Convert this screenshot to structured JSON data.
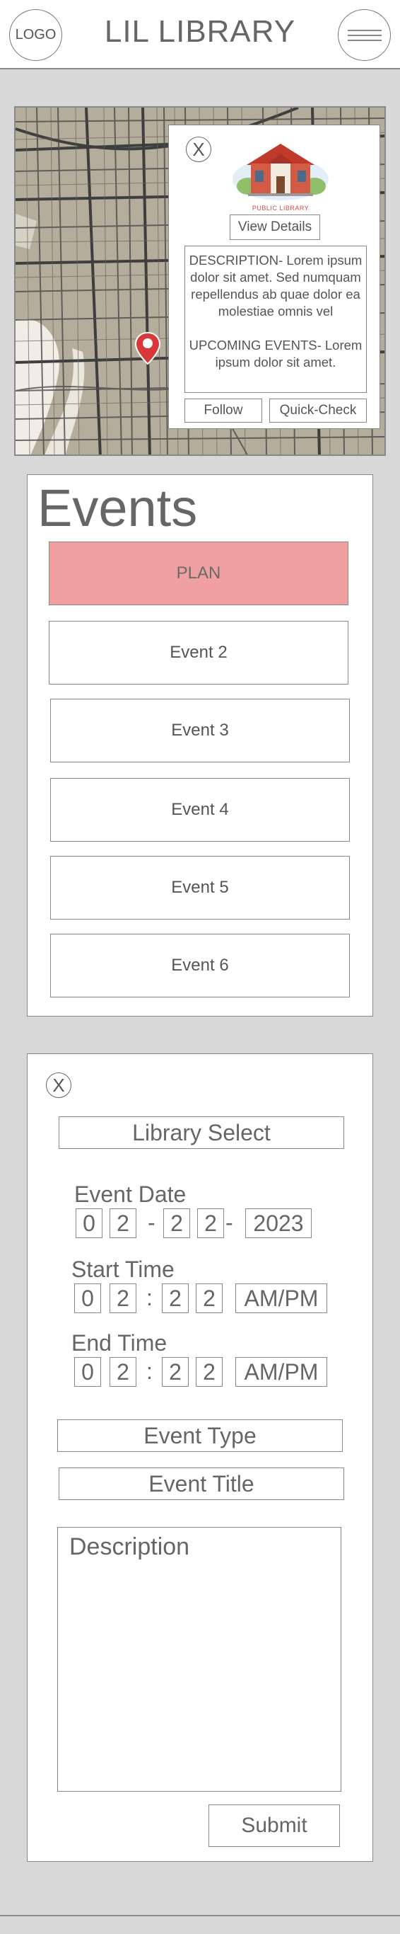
{
  "header": {
    "logo": "LOGO",
    "title": "LIL LIBRARY"
  },
  "map_popup": {
    "close": "X",
    "library_caption": "PUBLIC LIBRARY",
    "view_details": "View Details",
    "description": "DESCRIPTION- Lorem ipsum dolor sit amet. Sed numquam repellendus ab quae dolor ea molestiae omnis vel",
    "upcoming": "UPCOMING EVENTS- Lorem ipsum dolor sit amet.",
    "follow": "Follow",
    "quick_check": "Quick-Check"
  },
  "events": {
    "title": "Events",
    "items": [
      "PLAN",
      "Event 2",
      "Event 3",
      "Event 4",
      "Event 5",
      "Event 6"
    ]
  },
  "form": {
    "close": "X",
    "library_select": "Library Select",
    "event_date_label": "Event Date",
    "date": {
      "m1": "0",
      "m2": "2",
      "d1": "2",
      "d2": "2",
      "year": "2023",
      "sep1": "-",
      "sep2": "-"
    },
    "start_time_label": "Start Time",
    "start": {
      "h1": "0",
      "h2": "2",
      "m1": "2",
      "m2": "2",
      "ampm": "AM/PM",
      "sep": ":"
    },
    "end_time_label": "End Time",
    "end": {
      "h1": "0",
      "h2": "2",
      "m1": "2",
      "m2": "2",
      "ampm": "AM/PM",
      "sep": ":"
    },
    "event_type": "Event Type",
    "event_title": "Event Title",
    "description_placeholder": "Description",
    "submit": "Submit"
  },
  "colors": {
    "plan_highlight": "#f0a0a0",
    "map_pin": "#d9383a",
    "library_roof": "#c0392b"
  }
}
